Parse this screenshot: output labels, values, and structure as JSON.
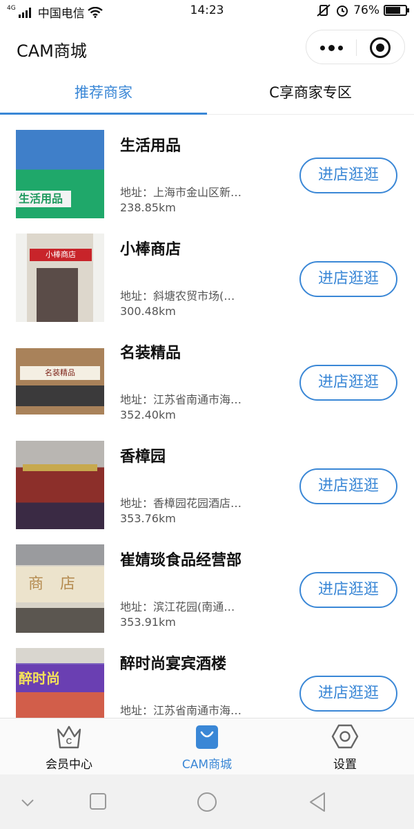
{
  "status_bar": {
    "network": "4G",
    "carrier": "中国电信",
    "time": "14:23",
    "battery_percent": "76%",
    "battery_level": 0.76,
    "icons": [
      "signal-icon",
      "wifi-icon",
      "vibrate-icon",
      "alarm-icon",
      "battery-icon"
    ]
  },
  "header": {
    "title": "CAM商城",
    "capsule_icons": [
      "more-icon",
      "close-miniprogram-icon"
    ]
  },
  "tabs": [
    {
      "label": "推荐商家",
      "active": true
    },
    {
      "label": "C享商家专区",
      "active": false
    }
  ],
  "stores": [
    {
      "name": "生活用品",
      "address": "地址：上海市金山区新…",
      "distance": "238.85km",
      "button": "进店逛逛",
      "thumb_text": "生活用品"
    },
    {
      "name": "小棒商店",
      "address": "地址：斜塘农贸市场(…",
      "distance": "300.48km",
      "button": "进店逛逛",
      "thumb_text": "小棒商店"
    },
    {
      "name": "名装精品",
      "address": "地址：江苏省南通市海…",
      "distance": "352.40km",
      "button": "进店逛逛",
      "thumb_text": "名装精品"
    },
    {
      "name": "香樟园",
      "address": "地址：香樟园花园酒店…",
      "distance": "353.76km",
      "button": "进店逛逛",
      "thumb_text": ""
    },
    {
      "name": "崔婧琰食品经营部",
      "address": "地址：滨江花园(南通…",
      "distance": "353.91km",
      "button": "进店逛逛",
      "thumb_text": "商店"
    },
    {
      "name": "醉时尚宴宾酒楼",
      "address": "地址：江苏省南通市海…",
      "distance": "",
      "button": "进店逛逛",
      "thumb_text": "醉时尚"
    }
  ],
  "tabbar": [
    {
      "label": "会员中心",
      "icon": "crown-c-icon",
      "active": false
    },
    {
      "label": "CAM商城",
      "icon": "shopping-bag-icon",
      "active": true
    },
    {
      "label": "设置",
      "icon": "hexagon-settings-icon",
      "active": false
    }
  ],
  "system_nav": [
    "down-chevron-icon",
    "recent-apps-icon",
    "home-icon",
    "back-icon"
  ],
  "colors": {
    "accent": "#3a87d6",
    "text": "#111111",
    "muted": "#555555"
  }
}
